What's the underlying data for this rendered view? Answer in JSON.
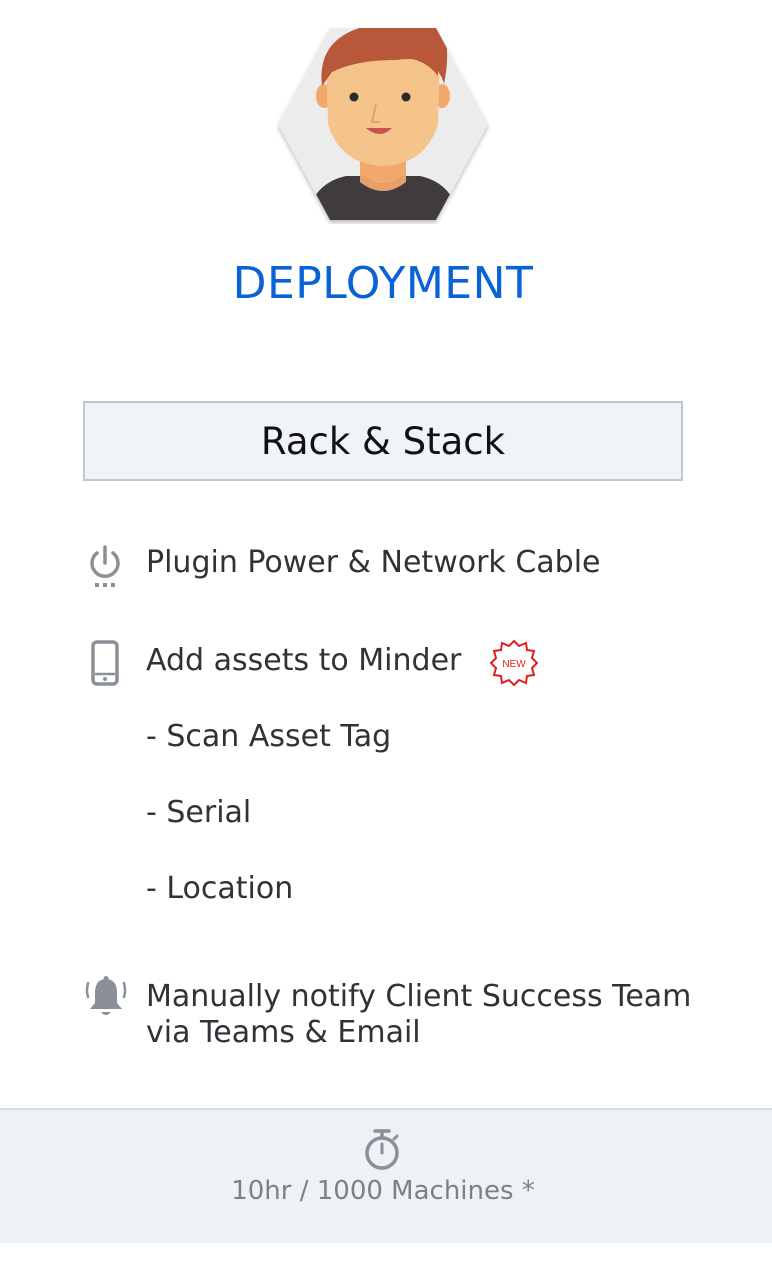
{
  "card": {
    "title": "DEPLOYMENT",
    "stage": "Rack & Stack",
    "steps": [
      {
        "icon": "power-icon",
        "text": "Plugin Power & Network Cable"
      },
      {
        "icon": "mobile-phone-icon",
        "text": "Add assets to Minder",
        "badge": "NEW"
      },
      {
        "text": "- Scan Asset Tag"
      },
      {
        "text": "- Serial"
      },
      {
        "text": "- Location"
      },
      {
        "icon": "bell-icon",
        "text_line1": "Manually notify Client Success Team",
        "text_line2": "via Teams & Email"
      }
    ],
    "footer": {
      "icon": "stopwatch-icon",
      "text": "10hr / 1000 Machines *"
    }
  },
  "colors": {
    "title": "#0a63d6",
    "badge": "#e11d1d",
    "icon": "#8a8f98",
    "footer_bg": "#eef2f6"
  }
}
